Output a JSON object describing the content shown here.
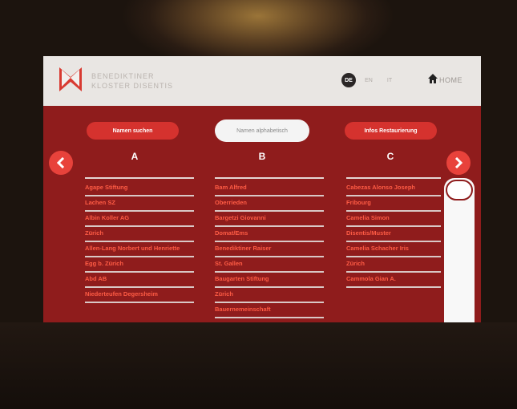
{
  "brand": {
    "line1": "BENEDIKTINER",
    "line2": "KLOSTER DISENTIS"
  },
  "languages": [
    {
      "code": "DE",
      "active": true
    },
    {
      "code": "EN",
      "active": false
    },
    {
      "code": "IT",
      "active": false
    }
  ],
  "home": {
    "label": "HOME"
  },
  "tabs": {
    "search": "Namen suchen",
    "alphabetical": "Namen alphabetisch",
    "restoration": "Infos Restaurierung"
  },
  "columns": [
    {
      "letter": "A",
      "items": [
        "Agape Stiftung",
        "Lachen SZ",
        "Albin Koller AG",
        "Zürich",
        "Allen-Lang Norbert und Henriette",
        "Egg b. Zürich",
        "Abd AB",
        "Niederteufen Degersheim"
      ]
    },
    {
      "letter": "B",
      "items": [
        "Bam Alfred",
        "Oberrieden",
        "Bargetzi Giovanni",
        "Domat/Ems",
        "Benediktiner Raiser",
        "St. Gallen",
        "Baugarten Stiftung",
        "Zürich",
        "Bauernemeinschaft"
      ]
    },
    {
      "letter": "C",
      "items": [
        "Cabezas Alonso Joseph",
        "Fribourg",
        "Camelia Simon",
        "Disentis/Muster",
        "Camelia Schacher Iris",
        "Zürich",
        "Cammola Gian A."
      ]
    }
  ],
  "colors": {
    "accent": "#d5322e",
    "panel": "#8f1c1c",
    "item_text": "#ff5c45",
    "header_bg": "#e9e6e3"
  },
  "icons": {
    "logo": "x-cross-logo",
    "home": "home-icon",
    "prev": "chevron-left-icon",
    "next": "chevron-right-icon"
  }
}
